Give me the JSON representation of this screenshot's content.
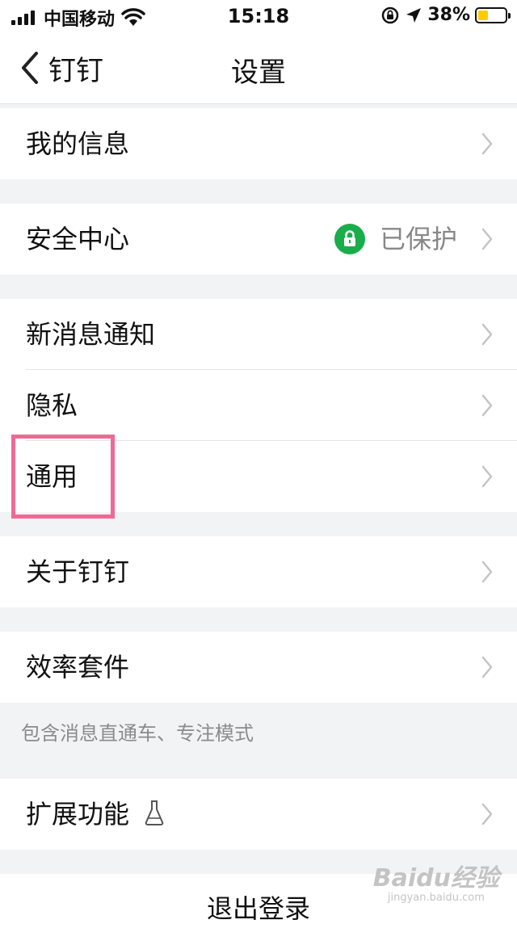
{
  "status_bar": {
    "carrier": "中国移动",
    "time": "15:18",
    "battery_percent": "38%",
    "battery_level": 0.38
  },
  "nav": {
    "back_label": "钉钉",
    "title": "设置"
  },
  "menu": {
    "my_info": "我的信息",
    "security_center": "安全中心",
    "security_status": "已保护",
    "new_message_notification": "新消息通知",
    "privacy": "隐私",
    "general": "通用",
    "about": "关于钉钉",
    "efficiency_suite": "效率套件",
    "efficiency_suite_note": "包含消息直通车、专注模式",
    "extensions": "扩展功能",
    "logout": "退出登录"
  },
  "icons": {
    "lock_color": "#1aad4b",
    "highlight_color": "#ee6a95"
  },
  "watermark": {
    "logo_text": "Baidu经验",
    "url": "jingyan.baidu.com"
  }
}
